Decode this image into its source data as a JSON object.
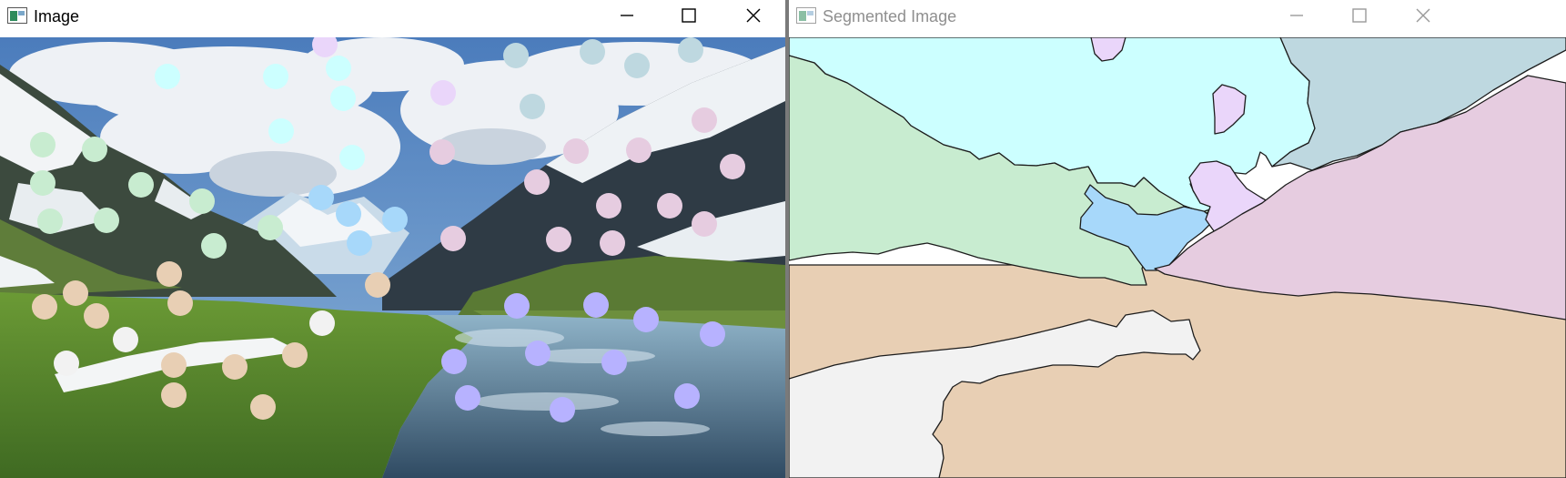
{
  "windows": {
    "image": {
      "title": "Image",
      "icon": "opencv-window-icon",
      "controls": [
        "minimize",
        "maximize",
        "close"
      ]
    },
    "segmented": {
      "title": "Segmented Image",
      "icon": "opencv-window-icon",
      "controls": [
        "minimize",
        "maximize",
        "close"
      ]
    }
  },
  "segment_colors": {
    "sky": "#ccffff",
    "sky_right": "#bed8e0",
    "mountain_left": "#c8ecd0",
    "snow_peaks": "#a7d8fa",
    "cloud_patch": "#ead6fa",
    "mountain_right": "#e6cce0",
    "meadow": "#e8cfb4",
    "snow_patch": "#f2f2f2",
    "river": "#b7b2ff"
  },
  "photo_colors": {
    "sky_top": "#3d72b8",
    "cloud": "#eef2f6",
    "mountain_dark": "#3e4a53",
    "snow": "#f4f6f8",
    "grass": "#5d8b2e",
    "water": "#4f6e8a"
  }
}
